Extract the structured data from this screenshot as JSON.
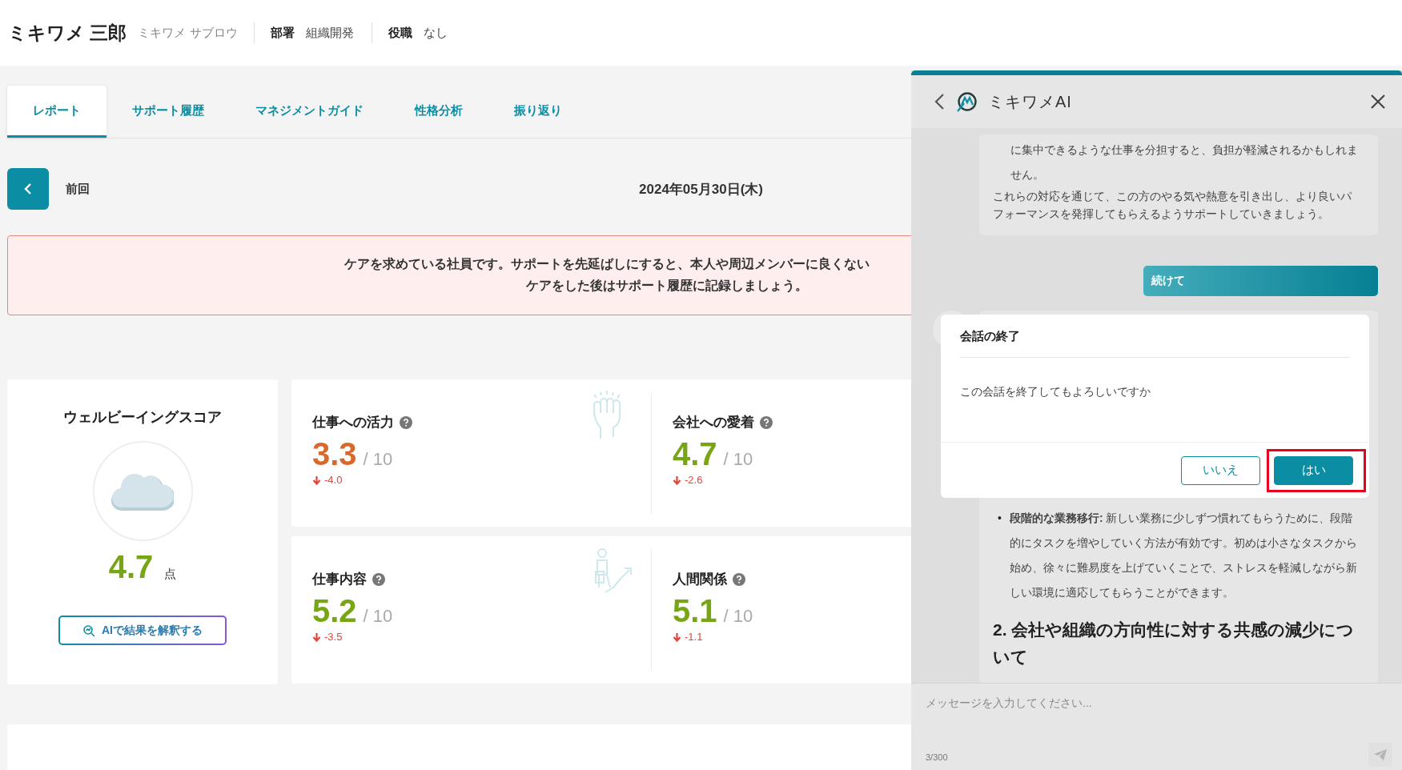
{
  "header": {
    "name": "ミキワメ 三郎",
    "kana": "ミキワメ サブロウ",
    "fields": [
      {
        "label": "部署",
        "value": "組織開発"
      },
      {
        "label": "役職",
        "value": "なし"
      }
    ]
  },
  "tabs": [
    {
      "label": "レポート",
      "selected": true
    },
    {
      "label": "サポート履歴",
      "selected": false
    },
    {
      "label": "マネジメントガイド",
      "selected": false
    },
    {
      "label": "性格分析",
      "selected": false
    },
    {
      "label": "振り返り",
      "selected": false
    }
  ],
  "report": {
    "back_label": "前回",
    "date": "2024年05月30日(木)"
  },
  "alert": {
    "lines": [
      "ケアを求めている社員です。サポートを先延ばしにすると、本人や周辺メンバーに良くない",
      "ケアをした後はサポート履歴に記録しましょう。"
    ]
  },
  "wellbeing": {
    "title": "ウェルビーイングスコア",
    "score": "4.7",
    "unit": "点",
    "button": "AIで結果を解釈する"
  },
  "metric_cards": [
    {
      "metrics": [
        {
          "title": "仕事への活力",
          "score": "3.3",
          "max": "/ 10",
          "change": "-4.0",
          "color": "#d9692a"
        },
        {
          "title": "会社への愛着",
          "score": "4.7",
          "max": "/ 10",
          "change": "-2.6",
          "color": "#77a514"
        }
      ]
    },
    {
      "metrics": [
        {
          "title": "仕事内容",
          "score": "5.2",
          "max": "/ 10",
          "change": "-3.5",
          "color": "#77a514"
        },
        {
          "title": "人間関係",
          "score": "5.1",
          "max": "/ 10",
          "change": "-1.1",
          "color": "#77a514"
        }
      ]
    }
  ],
  "chat": {
    "title": "ミキワメAI",
    "messages": [
      {
        "kind": "assistant",
        "blocks": [
          {
            "kind": "indented",
            "text": "に集中できるような仕事を分担すると、負担が軽減されるかもしれません。"
          },
          {
            "kind": "paragraph",
            "text": "これらの対応を通じて、この方のやる気や熱意を引き出し、より良いパフォーマンスを発揮してもらえるようサポートしていきましょう。"
          }
        ]
      },
      {
        "kind": "user",
        "text": "続けて"
      },
      {
        "kind": "assistant",
        "blocks": [
          {
            "kind": "bullet",
            "marker": "•",
            "text": "**段階的な業務移行:** 新しい業務に少しずつ慣れてもらうために、段階的にタスクを増やしていく方法が有効です。初めは小さなタスクから始め、徐々に難易度を上げていくことで、ストレスを軽減しながら新しい環境に適応してもらうことができます。"
          },
          {
            "kind": "heading",
            "text": "2. 会社や組織の方向性に対する共感の減少について"
          }
        ]
      }
    ],
    "input": {
      "placeholder": "メッセージを入力してください...",
      "counter": "3/300"
    }
  },
  "dialog": {
    "title": "会話の終了",
    "message": "この会話を終了してもよろしいですか",
    "buttons": [
      {
        "label": "いいえ",
        "kind": "secondary"
      },
      {
        "label": "はい",
        "kind": "primary",
        "highlighted": true
      }
    ]
  }
}
